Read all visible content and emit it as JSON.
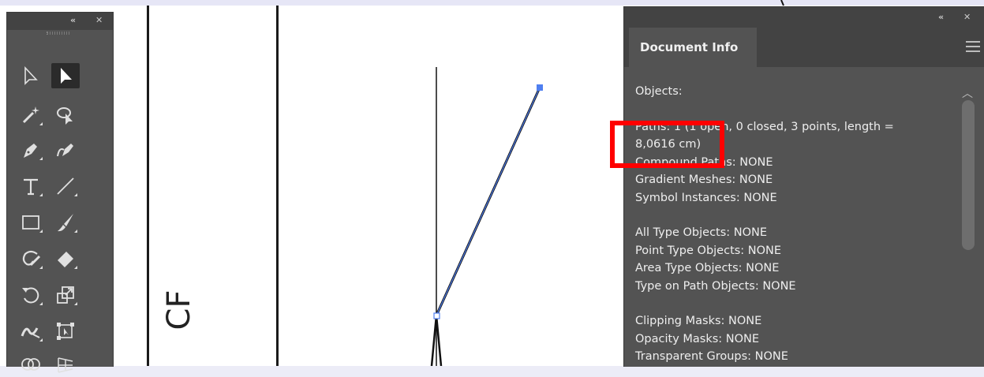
{
  "tools_panel": {
    "collapse_label": "«",
    "close_label": "✕",
    "tools": [
      {
        "name": "selection-tool",
        "icon": "direct-arrow-outline-icon"
      },
      {
        "name": "direct-selection-tool",
        "icon": "selection-arrow-filled-icon"
      },
      {
        "name": "magic-wand-tool",
        "icon": "magic-wand-icon"
      },
      {
        "name": "lasso-tool",
        "icon": "lasso-icon"
      },
      {
        "name": "pen-tool",
        "icon": "pen-icon"
      },
      {
        "name": "curvature-tool",
        "icon": "curvature-pen-icon"
      },
      {
        "name": "type-tool",
        "icon": "type-icon"
      },
      {
        "name": "line-segment-tool",
        "icon": "line-segment-icon"
      },
      {
        "name": "rectangle-tool",
        "icon": "rectangle-icon"
      },
      {
        "name": "paintbrush-tool",
        "icon": "paintbrush-icon"
      },
      {
        "name": "shaper-tool",
        "icon": "shaper-icon"
      },
      {
        "name": "eraser-tool",
        "icon": "eraser-icon"
      },
      {
        "name": "rotate-tool",
        "icon": "rotate-icon"
      },
      {
        "name": "scale-tool",
        "icon": "scale-icon"
      },
      {
        "name": "width-tool",
        "icon": "width-icon"
      },
      {
        "name": "free-transform-tool",
        "icon": "free-transform-icon"
      },
      {
        "name": "shape-builder-tool",
        "icon": "shape-builder-icon"
      },
      {
        "name": "perspective-grid-tool",
        "icon": "perspective-grid-icon"
      }
    ]
  },
  "canvas": {
    "rotated_label": "CF"
  },
  "document_info": {
    "collapse_label": "«",
    "close_label": "✕",
    "tab_label": "Document Info",
    "lines": {
      "objects": "Objects:",
      "paths_a": "Paths: 1 (1 open, 0 closed, 3 points, length =",
      "paths_b": "8,0616 cm)",
      "compound": "Compound Paths: NONE",
      "gradient": "Gradient Meshes: NONE",
      "symbol": "Symbol Instances: NONE",
      "all_type": "All Type Objects: NONE",
      "point_type": "Point Type Objects: NONE",
      "area_type": "Area Type Objects: NONE",
      "type_on_path": "Type on Path Objects: NONE",
      "clipping": "Clipping Masks: NONE",
      "opacity": "Opacity Masks: NONE",
      "transparent": "Transparent Groups: NONE"
    }
  },
  "colors": {
    "panel_bg": "#535353",
    "panel_header": "#434343",
    "selection_blue": "#4f7ff0",
    "highlight_red": "#ff0000"
  }
}
